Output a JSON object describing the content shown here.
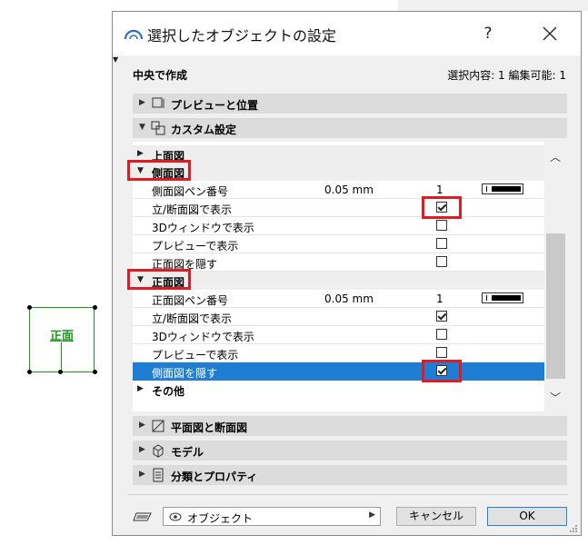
{
  "canvas": {
    "object_label": "正面"
  },
  "dialog": {
    "title": "選択したオブジェクトの設定",
    "help": "?",
    "header_left": "中央で作成",
    "header_right": "選択内容: 1 編集可能: 1",
    "panels": {
      "preview": "プレビューと位置",
      "custom": "カスタム設定",
      "plan": "平面図と断面図",
      "model": "モデル",
      "classification": "分類とプロパティ"
    },
    "tree": {
      "top_view": "上面図",
      "side_view": {
        "title": "側面図",
        "pen_label": "側面図ペン番号",
        "pen_value": "0.05 mm",
        "pen_number": "1",
        "show_section": "立/断面図で表示",
        "show_section_checked": true,
        "show_3d": "3Dウィンドウで表示",
        "show_3d_checked": false,
        "show_preview": "プレビューで表示",
        "show_preview_checked": false,
        "hide_front": "正面図を隠す",
        "hide_front_checked": false
      },
      "front_view": {
        "title": "正面図",
        "pen_label": "正面図ペン番号",
        "pen_value": "0.05 mm",
        "pen_number": "1",
        "show_section": "立/断面図で表示",
        "show_section_checked": true,
        "show_3d": "3Dウィンドウで表示",
        "show_3d_checked": false,
        "show_preview": "プレビューで表示",
        "show_preview_checked": false,
        "hide_side": "側面図を隠す",
        "hide_side_checked": true
      },
      "other": "その他"
    },
    "footer": {
      "layer_dropdown": "オブジェクト",
      "cancel": "キャンセル",
      "ok": "OK"
    }
  },
  "colors": {
    "selection": "#1f7ed3",
    "highlight": "#e21b23",
    "object": "#1a9a1a"
  }
}
